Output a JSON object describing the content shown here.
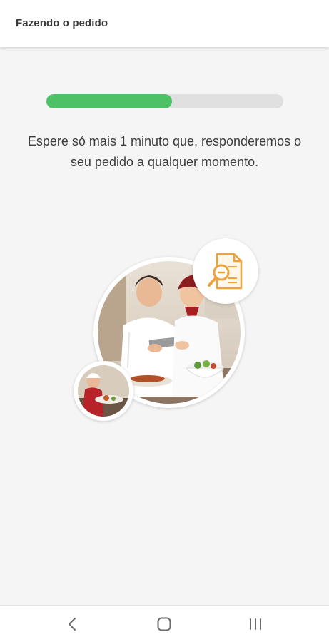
{
  "header": {
    "title": "Fazendo o pedido"
  },
  "progress": {
    "value": 0.53,
    "fill_color": "#4cc165",
    "track_color": "#e0e0e0"
  },
  "message": {
    "text": "Espere só mais 1 minuto que, responderemos o seu pedido a qualquer momento."
  },
  "illustration": {
    "main_photo": "chefs-with-tablet-photo",
    "small_photo": "chef-plating-photo",
    "badge_icon": "document-search-icon",
    "badge_color": "#f0a23a"
  },
  "navigation": {
    "back_icon": "back-icon",
    "home_icon": "home-icon",
    "recents_icon": "recents-icon"
  }
}
